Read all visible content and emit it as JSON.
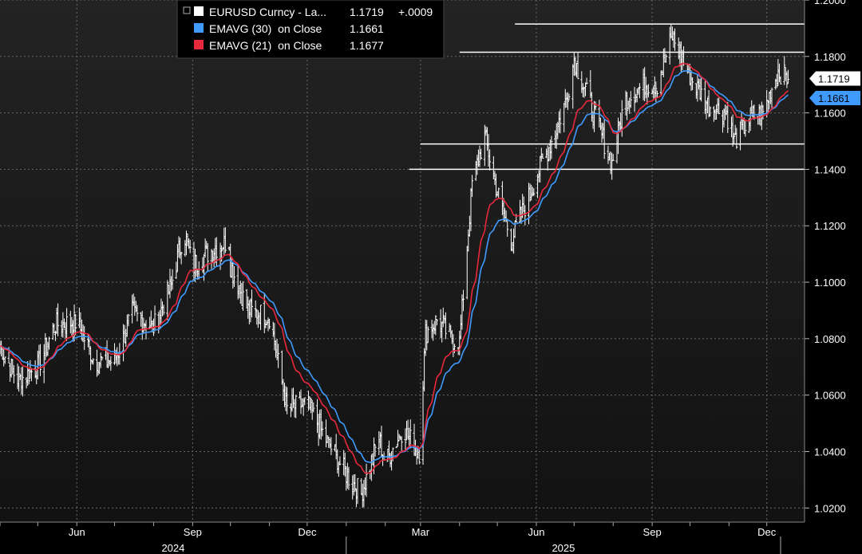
{
  "chart_data": {
    "type": "line",
    "legend": {
      "placement": "top-left",
      "entries": [
        {
          "name": "EURUSD Curncy - La...",
          "last": "1.1719",
          "change": "+.0009",
          "color": "#ffffff"
        },
        {
          "name": "EMAVG (30)  on Close",
          "last": "1.1661",
          "color": "#3f9bff"
        },
        {
          "name": "EMAVG (21)  on Close",
          "last": "1.1677",
          "color": "#e8283c"
        }
      ]
    },
    "y_axis": {
      "side": "right",
      "range": [
        1.015,
        1.2
      ],
      "ticks": [
        "1.0200",
        "1.0400",
        "1.0600",
        "1.0800",
        "1.1000",
        "1.1200",
        "1.1400",
        "1.1600",
        "1.1800",
        "1.2000"
      ]
    },
    "x_axis": {
      "month_ticks": [
        "Jun",
        "Sep",
        "Dec",
        "Mar",
        "Jun",
        "Sep",
        "Dec"
      ],
      "year_labels": [
        "2024",
        "2025"
      ],
      "range": [
        "2024-04-01",
        "2025-12-31"
      ]
    },
    "last_value_tags": [
      {
        "label": "1.1719",
        "value": 1.1719,
        "color": "#ffffff",
        "text_color": "#000000"
      },
      {
        "label": "1.1661",
        "value": 1.1661,
        "color": "#3f9bff",
        "text_color": "#000000"
      }
    ],
    "resistance_lines": [
      {
        "value": 1.1915,
        "from": "2025-05-15",
        "to": "2025-12-31"
      },
      {
        "value": 1.1815,
        "from": "2025-04-01",
        "to": "2025-12-31"
      },
      {
        "value": 1.149,
        "from": "2025-03-01",
        "to": "2025-12-31"
      },
      {
        "value": 1.14,
        "from": "2025-02-20",
        "to": "2025-12-31"
      }
    ],
    "price_path": [
      [
        "2024-04-01",
        1.0775
      ],
      [
        "2024-04-15",
        1.065
      ],
      [
        "2024-05-01",
        1.07
      ],
      [
        "2024-05-15",
        1.085
      ],
      [
        "2024-06-01",
        1.086
      ],
      [
        "2024-06-15",
        1.072
      ],
      [
        "2024-07-01",
        1.072
      ],
      [
        "2024-07-15",
        1.089
      ],
      [
        "2024-08-01",
        1.084
      ],
      [
        "2024-08-15",
        1.099
      ],
      [
        "2024-08-25",
        1.118
      ],
      [
        "2024-09-01",
        1.106
      ],
      [
        "2024-09-15",
        1.111
      ],
      [
        "2024-09-30",
        1.115
      ],
      [
        "2024-10-01",
        1.106
      ],
      [
        "2024-10-15",
        1.09
      ],
      [
        "2024-11-01",
        1.088
      ],
      [
        "2024-11-15",
        1.055
      ],
      [
        "2024-12-01",
        1.057
      ],
      [
        "2024-12-15",
        1.045
      ],
      [
        "2025-01-01",
        1.032
      ],
      [
        "2025-01-13",
        1.025
      ],
      [
        "2025-01-27",
        1.045
      ],
      [
        "2025-02-01",
        1.036
      ],
      [
        "2025-02-15",
        1.048
      ],
      [
        "2025-02-28",
        1.04
      ],
      [
        "2025-03-05",
        1.082
      ],
      [
        "2025-03-15",
        1.087
      ],
      [
        "2025-03-25",
        1.08
      ],
      [
        "2025-04-01",
        1.079
      ],
      [
        "2025-04-11",
        1.135
      ],
      [
        "2025-04-21",
        1.152
      ],
      [
        "2025-05-01",
        1.132
      ],
      [
        "2025-05-12",
        1.115
      ],
      [
        "2025-05-25",
        1.129
      ],
      [
        "2025-06-05",
        1.142
      ],
      [
        "2025-06-15",
        1.152
      ],
      [
        "2025-06-25",
        1.165
      ],
      [
        "2025-07-01",
        1.179
      ],
      [
        "2025-07-15",
        1.162
      ],
      [
        "2025-07-31",
        1.142
      ],
      [
        "2025-08-10",
        1.164
      ],
      [
        "2025-08-25",
        1.17
      ],
      [
        "2025-09-05",
        1.17
      ],
      [
        "2025-09-17",
        1.187
      ],
      [
        "2025-10-01",
        1.173
      ],
      [
        "2025-10-15",
        1.163
      ],
      [
        "2025-10-30",
        1.16
      ],
      [
        "2025-11-05",
        1.15
      ],
      [
        "2025-11-20",
        1.159
      ],
      [
        "2025-11-28",
        1.16
      ],
      [
        "2025-12-10",
        1.175
      ],
      [
        "2025-12-18",
        1.1719
      ]
    ]
  }
}
